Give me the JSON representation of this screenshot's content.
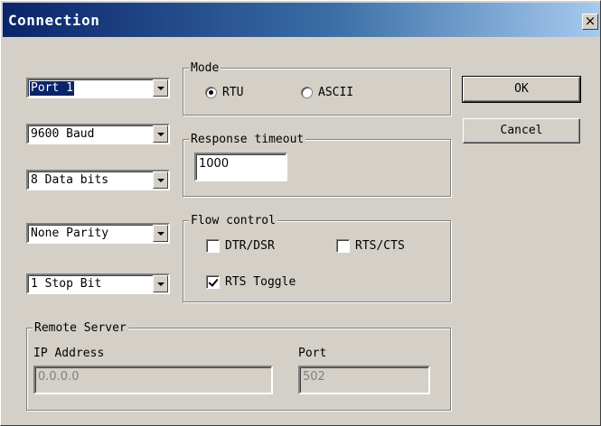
{
  "window": {
    "title": "Connection",
    "close_glyph": "×"
  },
  "port": {
    "value": "Port 1"
  },
  "baud": {
    "value": "9600 Baud"
  },
  "data_bits": {
    "value": "8 Data bits"
  },
  "parity": {
    "value": "None Parity"
  },
  "stop_bits": {
    "value": "1 Stop Bit"
  },
  "mode": {
    "legend": "Mode",
    "options": [
      {
        "label": "RTU",
        "selected": true
      },
      {
        "label": "ASCII",
        "selected": false
      }
    ]
  },
  "response_timeout": {
    "legend": "Response timeout",
    "value": "1000"
  },
  "flow_control": {
    "legend": "Flow control",
    "options": [
      {
        "label": "DTR/DSR",
        "checked": false
      },
      {
        "label": "RTS/CTS",
        "checked": false
      },
      {
        "label": "RTS Toggle",
        "checked": true
      }
    ]
  },
  "remote_server": {
    "legend": "Remote Server",
    "ip_label": "IP Address",
    "ip_value": "0.0.0.0",
    "port_label": "Port",
    "port_value": "502"
  },
  "buttons": {
    "ok": "OK",
    "cancel": "Cancel"
  },
  "colors": {
    "titlebar_start": "#0a246a",
    "titlebar_end": "#a6caf0",
    "face": "#d4d0c8"
  }
}
